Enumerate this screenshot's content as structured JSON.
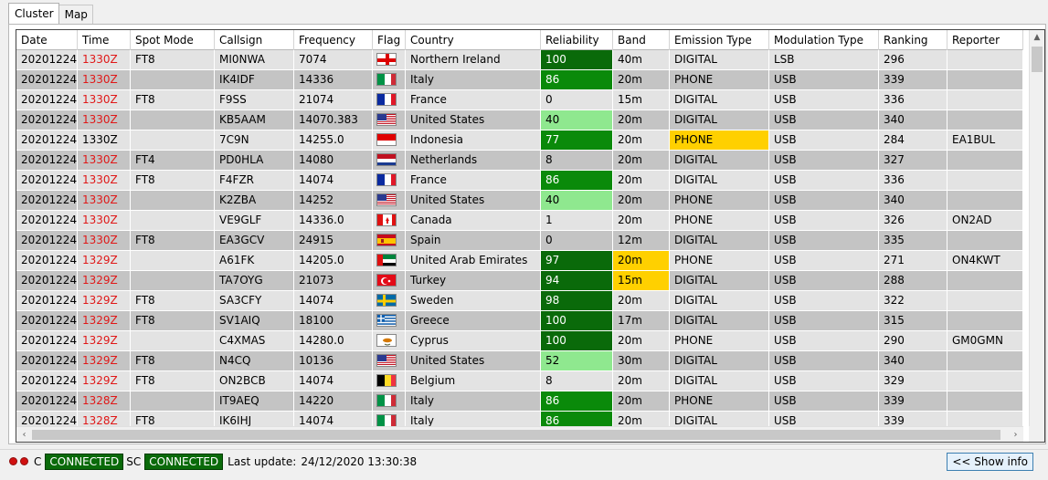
{
  "tabs": [
    {
      "label": "Cluster"
    },
    {
      "label": "Map"
    }
  ],
  "columns": [
    "Date",
    "Time",
    "Spot Mode",
    "Callsign",
    "Frequency",
    "Flag",
    "Country",
    "Reliability",
    "Band",
    "Emission Type",
    "Modulation Type",
    "Ranking",
    "Reporter"
  ],
  "rows": [
    {
      "date": "20201224",
      "time": "1330Z",
      "red": true,
      "mode": "FT8",
      "call": "MI0NWA",
      "freq": "7074",
      "flag": "nir",
      "country": "Northern Ireland",
      "rel": "100",
      "relc": "dark",
      "band": "40m",
      "bandc": "",
      "emis": "DIGITAL",
      "emisc": "",
      "mod": "LSB",
      "rank": "296",
      "rep": ""
    },
    {
      "date": "20201224",
      "time": "1330Z",
      "red": true,
      "mode": "",
      "call": "IK4IDF",
      "freq": "14336",
      "flag": "it",
      "country": "Italy",
      "rel": "86",
      "relc": "mid",
      "band": "20m",
      "bandc": "",
      "emis": "PHONE",
      "emisc": "",
      "mod": "USB",
      "rank": "339",
      "rep": ""
    },
    {
      "date": "20201224",
      "time": "1330Z",
      "red": true,
      "mode": "FT8",
      "call": "F9SS",
      "freq": "21074",
      "flag": "fr",
      "country": "France",
      "rel": "0",
      "relc": "",
      "band": "15m",
      "bandc": "",
      "emis": "DIGITAL",
      "emisc": "",
      "mod": "USB",
      "rank": "336",
      "rep": ""
    },
    {
      "date": "20201224",
      "time": "1330Z",
      "red": true,
      "mode": "",
      "call": "KB5AAM",
      "freq": "14070.383",
      "flag": "us",
      "country": "United States",
      "rel": "40",
      "relc": "light",
      "band": "20m",
      "bandc": "",
      "emis": "DIGITAL",
      "emisc": "",
      "mod": "USB",
      "rank": "340",
      "rep": ""
    },
    {
      "date": "20201224",
      "time": "1330Z",
      "red": false,
      "mode": "",
      "call": "7C9N",
      "freq": "14255.0",
      "flag": "id",
      "country": "Indonesia",
      "rel": "77",
      "relc": "mid",
      "band": "20m",
      "bandc": "",
      "emis": "PHONE",
      "emisc": "yellow",
      "mod": "USB",
      "rank": "284",
      "rep": "EA1BUL"
    },
    {
      "date": "20201224",
      "time": "1330Z",
      "red": true,
      "mode": "FT4",
      "call": "PD0HLA",
      "freq": "14080",
      "flag": "nl",
      "country": "Netherlands",
      "rel": "8",
      "relc": "",
      "band": "20m",
      "bandc": "",
      "emis": "DIGITAL",
      "emisc": "",
      "mod": "USB",
      "rank": "327",
      "rep": ""
    },
    {
      "date": "20201224",
      "time": "1330Z",
      "red": true,
      "mode": "FT8",
      "call": "F4FZR",
      "freq": "14074",
      "flag": "fr",
      "country": "France",
      "rel": "86",
      "relc": "mid",
      "band": "20m",
      "bandc": "",
      "emis": "DIGITAL",
      "emisc": "",
      "mod": "USB",
      "rank": "336",
      "rep": ""
    },
    {
      "date": "20201224",
      "time": "1330Z",
      "red": true,
      "mode": "",
      "call": "K2ZBA",
      "freq": "14252",
      "flag": "us",
      "country": "United States",
      "rel": "40",
      "relc": "light",
      "band": "20m",
      "bandc": "",
      "emis": "PHONE",
      "emisc": "",
      "mod": "USB",
      "rank": "340",
      "rep": ""
    },
    {
      "date": "20201224",
      "time": "1330Z",
      "red": true,
      "mode": "",
      "call": "VE9GLF",
      "freq": "14336.0",
      "flag": "ca",
      "country": "Canada",
      "rel": "1",
      "relc": "",
      "band": "20m",
      "bandc": "",
      "emis": "PHONE",
      "emisc": "",
      "mod": "USB",
      "rank": "326",
      "rep": "ON2AD"
    },
    {
      "date": "20201224",
      "time": "1330Z",
      "red": true,
      "mode": "FT8",
      "call": "EA3GCV",
      "freq": "24915",
      "flag": "es",
      "country": "Spain",
      "rel": "0",
      "relc": "",
      "band": "12m",
      "bandc": "",
      "emis": "DIGITAL",
      "emisc": "",
      "mod": "USB",
      "rank": "335",
      "rep": ""
    },
    {
      "date": "20201224",
      "time": "1329Z",
      "red": true,
      "mode": "",
      "call": "A61FK",
      "freq": "14205.0",
      "flag": "ae",
      "country": "United Arab Emirates",
      "rel": "97",
      "relc": "dark",
      "band": "20m",
      "bandc": "yellow",
      "emis": "PHONE",
      "emisc": "",
      "mod": "USB",
      "rank": "271",
      "rep": "ON4KWT"
    },
    {
      "date": "20201224",
      "time": "1329Z",
      "red": true,
      "mode": "",
      "call": "TA7OYG",
      "freq": "21073",
      "flag": "tr",
      "country": "Turkey",
      "rel": "94",
      "relc": "dark",
      "band": "15m",
      "bandc": "yellow",
      "emis": "DIGITAL",
      "emisc": "",
      "mod": "USB",
      "rank": "288",
      "rep": ""
    },
    {
      "date": "20201224",
      "time": "1329Z",
      "red": true,
      "mode": "FT8",
      "call": "SA3CFY",
      "freq": "14074",
      "flag": "se",
      "country": "Sweden",
      "rel": "98",
      "relc": "dark",
      "band": "20m",
      "bandc": "",
      "emis": "DIGITAL",
      "emisc": "",
      "mod": "USB",
      "rank": "322",
      "rep": ""
    },
    {
      "date": "20201224",
      "time": "1329Z",
      "red": true,
      "mode": "FT8",
      "call": "SV1AIQ",
      "freq": "18100",
      "flag": "gr",
      "country": "Greece",
      "rel": "100",
      "relc": "dark",
      "band": "17m",
      "bandc": "",
      "emis": "DIGITAL",
      "emisc": "",
      "mod": "USB",
      "rank": "315",
      "rep": ""
    },
    {
      "date": "20201224",
      "time": "1329Z",
      "red": true,
      "mode": "",
      "call": "C4XMAS",
      "freq": "14280.0",
      "flag": "cy",
      "country": "Cyprus",
      "rel": "100",
      "relc": "dark",
      "band": "20m",
      "bandc": "",
      "emis": "PHONE",
      "emisc": "",
      "mod": "USB",
      "rank": "290",
      "rep": "GM0GMN"
    },
    {
      "date": "20201224",
      "time": "1329Z",
      "red": true,
      "mode": "FT8",
      "call": "N4CQ",
      "freq": "10136",
      "flag": "us",
      "country": "United States",
      "rel": "52",
      "relc": "light",
      "band": "30m",
      "bandc": "",
      "emis": "DIGITAL",
      "emisc": "",
      "mod": "USB",
      "rank": "340",
      "rep": ""
    },
    {
      "date": "20201224",
      "time": "1329Z",
      "red": true,
      "mode": "FT8",
      "call": "ON2BCB",
      "freq": "14074",
      "flag": "be",
      "country": "Belgium",
      "rel": "8",
      "relc": "",
      "band": "20m",
      "bandc": "",
      "emis": "DIGITAL",
      "emisc": "",
      "mod": "USB",
      "rank": "329",
      "rep": ""
    },
    {
      "date": "20201224",
      "time": "1328Z",
      "red": true,
      "mode": "",
      "call": "IT9AEQ",
      "freq": "14220",
      "flag": "it",
      "country": "Italy",
      "rel": "86",
      "relc": "mid",
      "band": "20m",
      "bandc": "",
      "emis": "PHONE",
      "emisc": "",
      "mod": "USB",
      "rank": "339",
      "rep": ""
    },
    {
      "date": "20201224",
      "time": "1328Z",
      "red": true,
      "mode": "FT8",
      "call": "IK6IHJ",
      "freq": "14074",
      "flag": "it",
      "country": "Italy",
      "rel": "86",
      "relc": "mid",
      "band": "20m",
      "bandc": "",
      "emis": "DIGITAL",
      "emisc": "",
      "mod": "USB",
      "rank": "339",
      "rep": ""
    }
  ],
  "status": {
    "c_label": "C",
    "c_status": "CONNECTED",
    "sc_label": "SC",
    "sc_status": "CONNECTED",
    "last_update_label": "Last update:",
    "last_update_value": "24/12/2020 13:30:38",
    "show_info": "<< Show info"
  },
  "colors": {
    "connected_bg": "#0a6a0a",
    "reliability_dark": "#0a6a0a",
    "reliability_mid": "#0a8a0a",
    "reliability_light": "#8fe88f",
    "highlight_yellow": "#ffd000",
    "time_red": "#e01818"
  }
}
